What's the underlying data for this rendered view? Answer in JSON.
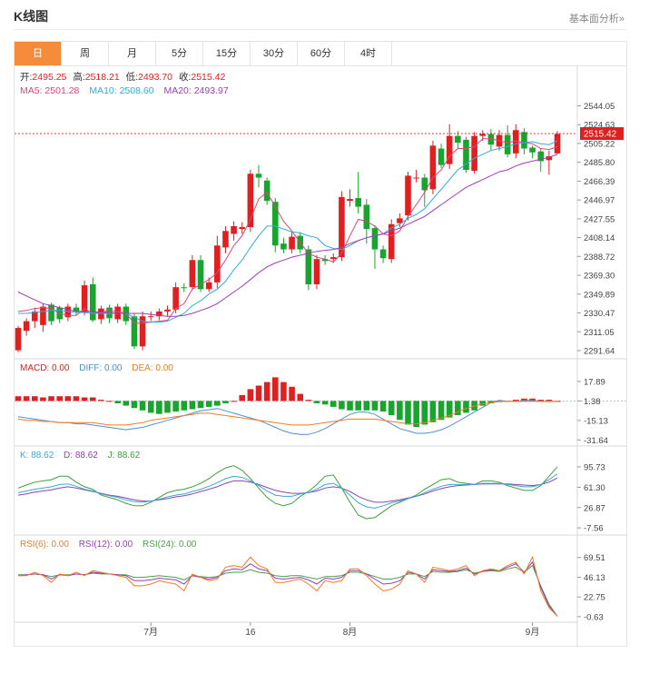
{
  "header": {
    "title": "K线图",
    "link": "基本面分析»"
  },
  "tabs": [
    "日",
    "周",
    "月",
    "5分",
    "15分",
    "30分",
    "60分",
    "4时"
  ],
  "colors": {
    "up": "#e02020",
    "down": "#17a52e",
    "ma5": "#e0457b",
    "ma10": "#34a9df",
    "ma20": "#a23bb8",
    "dif": "#4a90d9",
    "dea": "#f07c22",
    "k": "#3ba7d8",
    "d": "#8e44ad",
    "j": "#3aa13a",
    "rsi6": "#f07c22",
    "rsi12": "#9b3bb8",
    "rsi24": "#4aa04a",
    "accent": "#f58c3c"
  },
  "info": {
    "open_label": "开:",
    "open": "2495.25",
    "high_label": "高:",
    "high": "2518.21",
    "low_label": "低:",
    "low": "2493.70",
    "close_label": "收:",
    "close": "2515.42",
    "ma5": "MA5: 2501.28",
    "ma10": "MA10: 2508.60",
    "ma20": "MA20: 2493.97",
    "macd": "MACD: 0.00",
    "diff": "DIFF: 0.00",
    "dea": "DEA: 0.00",
    "k": "K: 88.62",
    "d": "D: 88.62",
    "j": "J: 88.62",
    "rsi6": "RSI(6): 0.00",
    "rsi12": "RSI(12): 0.00",
    "rsi24": "RSI(24): 0.00",
    "last_price": "2515.42"
  },
  "chart_data": [
    {
      "type": "candlestick",
      "y_ticks": [
        "2544.05",
        "2524.63",
        "2505.22",
        "2485.80",
        "2466.39",
        "2446.97",
        "2427.55",
        "2408.14",
        "2388.72",
        "2369.30",
        "2349.89",
        "2330.47",
        "2311.05",
        "2291.64"
      ],
      "x_ticks": [
        "7月",
        "16",
        "8月",
        "9月"
      ],
      "x_tick_index": [
        16,
        28,
        40,
        62
      ],
      "ylim": [
        2286,
        2552
      ],
      "candles": [
        [
          2292,
          2315,
          2290,
          2317
        ],
        [
          2312,
          2322,
          2307,
          2325
        ],
        [
          2322,
          2332,
          2315,
          2336
        ],
        [
          2318,
          2337,
          2311,
          2340
        ],
        [
          2339,
          2322,
          2318,
          2341
        ],
        [
          2336,
          2324,
          2320,
          2338
        ],
        [
          2326,
          2337,
          2322,
          2340
        ],
        [
          2336,
          2332,
          2328,
          2340
        ],
        [
          2331,
          2359,
          2328,
          2364
        ],
        [
          2360,
          2323,
          2321,
          2367
        ],
        [
          2324,
          2335,
          2319,
          2338
        ],
        [
          2336,
          2325,
          2320,
          2339
        ],
        [
          2324,
          2337,
          2320,
          2340
        ],
        [
          2337,
          2322,
          2318,
          2340
        ],
        [
          2327,
          2296,
          2293,
          2330
        ],
        [
          2296,
          2327,
          2292,
          2332
        ],
        [
          2327,
          2327,
          2322,
          2332
        ],
        [
          2327,
          2332,
          2323,
          2335
        ],
        [
          2332,
          2334,
          2327,
          2338
        ],
        [
          2334,
          2357,
          2330,
          2362
        ],
        [
          2357,
          2356,
          2352,
          2361
        ],
        [
          2357,
          2385,
          2354,
          2390
        ],
        [
          2385,
          2355,
          2352,
          2390
        ],
        [
          2355,
          2362,
          2352,
          2367
        ],
        [
          2362,
          2400,
          2356,
          2410
        ],
        [
          2398,
          2415,
          2392,
          2420
        ],
        [
          2412,
          2420,
          2405,
          2425
        ],
        [
          2417,
          2419,
          2412,
          2424
        ],
        [
          2419,
          2474,
          2414,
          2478
        ],
        [
          2474,
          2470,
          2460,
          2483
        ],
        [
          2467,
          2446,
          2442,
          2470
        ],
        [
          2445,
          2400,
          2393,
          2449
        ],
        [
          2402,
          2396,
          2392,
          2408
        ],
        [
          2396,
          2409,
          2392,
          2414
        ],
        [
          2410,
          2396,
          2392,
          2414
        ],
        [
          2396,
          2360,
          2354,
          2400
        ],
        [
          2360,
          2386,
          2355,
          2390
        ],
        [
          2386,
          2384,
          2380,
          2390
        ],
        [
          2386,
          2388,
          2382,
          2392
        ],
        [
          2388,
          2450,
          2384,
          2456
        ],
        [
          2446,
          2448,
          2440,
          2458
        ],
        [
          2449,
          2440,
          2433,
          2476
        ],
        [
          2442,
          2417,
          2402,
          2448
        ],
        [
          2418,
          2396,
          2376,
          2421
        ],
        [
          2396,
          2387,
          2382,
          2400
        ],
        [
          2386,
          2422,
          2382,
          2427
        ],
        [
          2423,
          2428,
          2419,
          2433
        ],
        [
          2431,
          2472,
          2426,
          2476
        ],
        [
          2470,
          2470,
          2465,
          2478
        ],
        [
          2470,
          2457,
          2440,
          2474
        ],
        [
          2458,
          2503,
          2453,
          2508
        ],
        [
          2500,
          2483,
          2480,
          2505
        ],
        [
          2484,
          2513,
          2479,
          2525
        ],
        [
          2513,
          2506,
          2500,
          2518
        ],
        [
          2509,
          2478,
          2475,
          2512
        ],
        [
          2477,
          2513,
          2474,
          2517
        ],
        [
          2513,
          2515,
          2508,
          2519
        ],
        [
          2515,
          2504,
          2498,
          2520
        ],
        [
          2502,
          2514,
          2498,
          2519
        ],
        [
          2514,
          2494,
          2491,
          2524
        ],
        [
          2495,
          2519,
          2490,
          2525
        ],
        [
          2517,
          2500,
          2494,
          2521
        ],
        [
          2501,
          2496,
          2490,
          2503
        ],
        [
          2497,
          2487,
          2476,
          2500
        ],
        [
          2488,
          2492,
          2473,
          2498
        ],
        [
          2495,
          2515,
          2494,
          2518
        ]
      ],
      "ma5": [
        2332,
        2333,
        2335,
        2336,
        2335,
        2330,
        2328,
        2328,
        2335,
        2330,
        2331,
        2333,
        2332,
        2330,
        2320,
        2320,
        2321,
        2322,
        2323,
        2335,
        2340,
        2355,
        2360,
        2365,
        2372,
        2385,
        2400,
        2410,
        2427,
        2448,
        2455,
        2440,
        2425,
        2415,
        2403,
        2392,
        2388,
        2386,
        2383,
        2392,
        2410,
        2427,
        2425,
        2420,
        2412,
        2410,
        2415,
        2430,
        2442,
        2455,
        2470,
        2478,
        2492,
        2500,
        2500,
        2502,
        2510,
        2510,
        2508,
        2506,
        2508,
        2506,
        2505,
        2500,
        2499,
        2502
      ],
      "ma10": [
        2330,
        2330,
        2331,
        2332,
        2333,
        2333,
        2332,
        2331,
        2331,
        2330,
        2330,
        2330,
        2330,
        2330,
        2326,
        2322,
        2321,
        2321,
        2322,
        2326,
        2330,
        2338,
        2343,
        2350,
        2355,
        2363,
        2375,
        2385,
        2398,
        2410,
        2420,
        2420,
        2417,
        2414,
        2413,
        2410,
        2408,
        2400,
        2397,
        2396,
        2400,
        2405,
        2408,
        2410,
        2412,
        2418,
        2422,
        2428,
        2432,
        2438,
        2448,
        2458,
        2468,
        2478,
        2484,
        2490,
        2494,
        2498,
        2500,
        2502,
        2505,
        2506,
        2507,
        2505,
        2504,
        2508
      ],
      "ma20": [
        2352,
        2348,
        2344,
        2340,
        2338,
        2336,
        2334,
        2332,
        2332,
        2332,
        2331,
        2331,
        2330,
        2330,
        2330,
        2330,
        2329,
        2328,
        2327,
        2327,
        2328,
        2330,
        2333,
        2336,
        2340,
        2346,
        2352,
        2358,
        2365,
        2372,
        2378,
        2382,
        2385,
        2388,
        2390,
        2392,
        2394,
        2395,
        2396,
        2398,
        2402,
        2405,
        2408,
        2410,
        2412,
        2415,
        2418,
        2422,
        2426,
        2430,
        2436,
        2442,
        2448,
        2454,
        2460,
        2464,
        2468,
        2472,
        2476,
        2478,
        2482,
        2485,
        2487,
        2489,
        2491,
        2494
      ]
    },
    {
      "type": "bar",
      "name": "MACD",
      "y_ticks": [
        "17.89",
        "1.38",
        "-15.13",
        "-31.64"
      ],
      "ylim": [
        -36,
        24
      ],
      "zero": 1.38,
      "macd": [
        4,
        4,
        4,
        3,
        4,
        4,
        4,
        4,
        3,
        3,
        1,
        0,
        -2,
        -4,
        -6,
        -8,
        -10,
        -11,
        -10,
        -9,
        -8,
        -7,
        -6,
        -5,
        -4,
        -2,
        0,
        5,
        10,
        13,
        16,
        20,
        16,
        12,
        6,
        1,
        -2,
        -3,
        -5,
        -7,
        -8,
        -8,
        -8,
        -8,
        -9,
        -12,
        -16,
        -20,
        -22,
        -20,
        -18,
        -16,
        -14,
        -12,
        -10,
        -8,
        -4,
        -2,
        -1,
        0,
        1,
        2,
        2,
        1,
        1,
        0,
        -1,
        -2,
        -2,
        -2,
        -1
      ],
      "dif": [
        -12,
        -13,
        -14,
        -15,
        -16,
        -17,
        -17,
        -18,
        -18,
        -19,
        -20,
        -21,
        -22,
        -23,
        -22,
        -21,
        -19,
        -17,
        -15,
        -13,
        -11,
        -9,
        -7,
        -6,
        -5,
        -7,
        -9,
        -11,
        -13,
        -15,
        -18,
        -21,
        -24,
        -26,
        -27,
        -27,
        -25,
        -22,
        -18,
        -14,
        -10,
        -8,
        -8,
        -10,
        -14,
        -18,
        -22,
        -24,
        -26,
        -26,
        -25,
        -23,
        -20,
        -16,
        -12,
        -8,
        -4,
        0,
        2,
        1,
        1,
        2,
        2,
        1,
        1,
        1,
        1,
        0,
        0,
        0,
        1
      ],
      "dea": [
        -14,
        -15,
        -15,
        -16,
        -16,
        -17,
        -17,
        -17,
        -17,
        -17,
        -18,
        -19,
        -19,
        -19,
        -18,
        -17,
        -15,
        -14,
        -13,
        -12,
        -11,
        -10,
        -9,
        -9,
        -10,
        -11,
        -12,
        -13,
        -14,
        -15,
        -16,
        -17,
        -18,
        -19,
        -19,
        -19,
        -18,
        -17,
        -16,
        -15,
        -14,
        -14,
        -14,
        -14,
        -15,
        -16,
        -17,
        -18,
        -18,
        -17,
        -15,
        -13,
        -11,
        -8,
        -5,
        -3,
        -1,
        0,
        1,
        1,
        1,
        1,
        1,
        1,
        1,
        1,
        1,
        1,
        0,
        0,
        1
      ]
    },
    {
      "type": "line",
      "name": "KDJ",
      "y_ticks": [
        "95.73",
        "61.30",
        "26.87",
        "-7.56"
      ],
      "ylim": [
        -15,
        105
      ],
      "k": [
        52,
        55,
        58,
        60,
        62,
        66,
        67,
        63,
        58,
        55,
        50,
        47,
        44,
        40,
        37,
        36,
        38,
        41,
        45,
        48,
        50,
        54,
        58,
        63,
        69,
        76,
        80,
        78,
        72,
        64,
        55,
        48,
        46,
        46,
        50,
        52,
        58,
        66,
        68,
        60,
        48,
        35,
        28,
        26,
        30,
        35,
        38,
        42,
        46,
        52,
        58,
        63,
        66,
        66,
        66,
        66,
        68,
        68,
        68,
        66,
        64,
        62,
        62,
        66,
        74,
        84,
        88
      ],
      "d": [
        48,
        50,
        53,
        55,
        57,
        60,
        62,
        60,
        57,
        54,
        51,
        48,
        46,
        43,
        40,
        38,
        38,
        40,
        42,
        45,
        47,
        50,
        54,
        58,
        62,
        68,
        72,
        72,
        70,
        66,
        61,
        56,
        53,
        51,
        51,
        52,
        55,
        60,
        62,
        60,
        54,
        46,
        40,
        36,
        36,
        38,
        40,
        43,
        46,
        50,
        55,
        59,
        62,
        64,
        65,
        66,
        67,
        67,
        67,
        67,
        66,
        65,
        64,
        66,
        70,
        77,
        83
      ],
      "j": [
        60,
        65,
        70,
        72,
        74,
        80,
        80,
        70,
        62,
        58,
        48,
        44,
        40,
        34,
        30,
        30,
        36,
        44,
        52,
        56,
        58,
        62,
        68,
        76,
        86,
        94,
        98,
        90,
        76,
        60,
        44,
        34,
        30,
        34,
        46,
        54,
        66,
        80,
        82,
        60,
        36,
        14,
        8,
        10,
        20,
        30,
        36,
        42,
        48,
        58,
        66,
        74,
        76,
        70,
        68,
        66,
        72,
        72,
        70,
        64,
        60,
        56,
        56,
        64,
        80,
        96,
        98
      ]
    },
    {
      "type": "line",
      "name": "RSI",
      "y_ticks": [
        "69.51",
        "46.13",
        "22.75",
        "-0.63"
      ],
      "ylim": [
        -5,
        80
      ],
      "rsi6": [
        48,
        48,
        52,
        48,
        40,
        50,
        48,
        52,
        48,
        54,
        52,
        50,
        48,
        46,
        36,
        36,
        38,
        42,
        40,
        38,
        30,
        50,
        46,
        42,
        44,
        58,
        60,
        58,
        70,
        60,
        56,
        40,
        40,
        42,
        44,
        38,
        30,
        42,
        40,
        42,
        56,
        56,
        48,
        38,
        30,
        32,
        38,
        54,
        50,
        40,
        58,
        56,
        54,
        56,
        60,
        48,
        54,
        56,
        54,
        60,
        64,
        50,
        70,
        30,
        10,
        0,
        0
      ],
      "rsi12": [
        48,
        49,
        50,
        49,
        44,
        49,
        48,
        50,
        49,
        52,
        51,
        50,
        49,
        48,
        42,
        42,
        43,
        45,
        44,
        43,
        38,
        48,
        46,
        44,
        46,
        54,
        56,
        55,
        62,
        56,
        54,
        45,
        44,
        45,
        46,
        43,
        38,
        45,
        44,
        46,
        54,
        54,
        50,
        44,
        38,
        39,
        42,
        52,
        50,
        44,
        55,
        54,
        53,
        54,
        57,
        50,
        53,
        55,
        54,
        58,
        62,
        52,
        64,
        34,
        12,
        0,
        0
      ],
      "rsi24": [
        49,
        49,
        50,
        49,
        47,
        49,
        49,
        50,
        49,
        51,
        50,
        50,
        49,
        49,
        46,
        46,
        47,
        48,
        47,
        46,
        43,
        48,
        47,
        46,
        47,
        51,
        52,
        52,
        55,
        52,
        51,
        48,
        47,
        48,
        48,
        46,
        44,
        47,
        47,
        48,
        52,
        52,
        50,
        47,
        44,
        44,
        46,
        50,
        50,
        47,
        53,
        52,
        52,
        53,
        55,
        51,
        53,
        54,
        53,
        56,
        58,
        52,
        60,
        36,
        14,
        0,
        0
      ]
    }
  ]
}
